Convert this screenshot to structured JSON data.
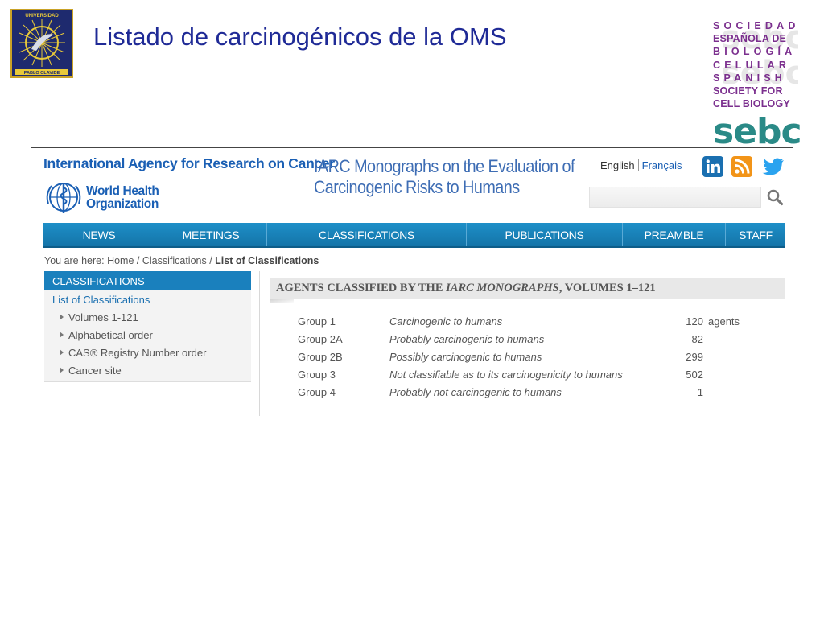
{
  "slide": {
    "title": "Listado de carcinogénicos de la OMS",
    "logo_left": {
      "icon": "university-seal-icon",
      "top_text": "UNIVERSIDAD",
      "bottom_text": "PABLO OLAVIDE",
      "left_text": "SEVILLA",
      "right_text": "AÑO 1997"
    },
    "logo_right": {
      "lines": [
        "SOCIEDAD",
        "ESPAÑOLA DE",
        "BIOLOGÍA",
        "CELULAR",
        "SPANISH",
        "SOCIETY FOR",
        "CELL BIOLOGY"
      ],
      "word": "sebc"
    }
  },
  "site": {
    "brand": "International Agency for Research on Cancer",
    "who_name_line1": "World Health",
    "who_name_line2": "Organization",
    "monographs_title_line1": "IARC Monographs on the Evaluation of",
    "monographs_title_line2": "Carcinogenic Risks to Humans",
    "lang_en": "English",
    "lang_fr": "Français",
    "social": [
      "linkedin-icon",
      "rss-icon",
      "twitter-icon"
    ],
    "search_placeholder": ""
  },
  "nav": [
    {
      "label": "NEWS"
    },
    {
      "label": "MEETINGS"
    },
    {
      "label": "CLASSIFICATIONS"
    },
    {
      "label": "PUBLICATIONS"
    },
    {
      "label": "PREAMBLE"
    },
    {
      "label": "STAFF"
    }
  ],
  "breadcrumb": {
    "prefix": "You are here: Home / Classifications / ",
    "current": "List of Classifications"
  },
  "sidebar": {
    "title": "CLASSIFICATIONS",
    "items": [
      {
        "label": "List of Classifications"
      },
      {
        "label": "Volumes 1-121"
      },
      {
        "label": "Alphabetical order"
      },
      {
        "label": "CAS® Registry Number order"
      },
      {
        "label": "Cancer site"
      }
    ]
  },
  "agents": {
    "heading_part1": "AGENTS CLASSIFIED BY THE ",
    "heading_italic": "IARC MONOGRAPHS",
    "heading_part2": ", VOLUMES 1–121",
    "unit": "agents",
    "groups": [
      {
        "name": "Group 1",
        "desc": "Carcinogenic to humans",
        "count": "120"
      },
      {
        "name": "Group 2A",
        "desc": "Probably carcinogenic to humans",
        "count": "82"
      },
      {
        "name": "Group 2B",
        "desc": "Possibly carcinogenic to humans",
        "count": "299"
      },
      {
        "name": "Group 3",
        "desc": "Not classifiable as to its carcinogenicity to humans",
        "count": "502"
      },
      {
        "name": "Group 4",
        "desc": "Probably not carcinogenic to humans",
        "count": "1"
      }
    ]
  },
  "colors": {
    "title_blue": "#1f2a96",
    "nav_blue": "#1a80bd",
    "sebc_purple": "#7b2f8e",
    "sebc_teal": "#2a8a87"
  }
}
